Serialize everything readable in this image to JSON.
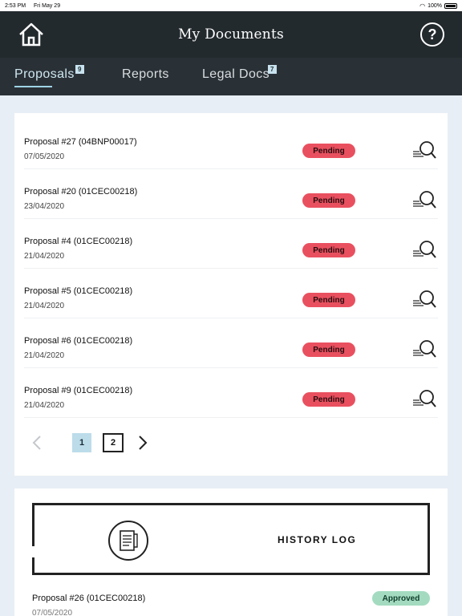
{
  "status_bar": {
    "time": "2:53 PM",
    "date": "Fri May 29",
    "battery": "100%"
  },
  "header": {
    "title": "My Documents"
  },
  "tabs": [
    {
      "label": "Proposals",
      "badge": "9",
      "active": true
    },
    {
      "label": "Reports",
      "badge": "",
      "active": false
    },
    {
      "label": "Legal Docs",
      "badge": "7",
      "active": false
    }
  ],
  "proposals": [
    {
      "title": "Proposal #27 (04BNP00017)",
      "date": "07/05/2020",
      "status": "Pending"
    },
    {
      "title": "Proposal #20 (01CEC00218)",
      "date": "23/04/2020",
      "status": "Pending"
    },
    {
      "title": "Proposal #4 (01CEC00218)",
      "date": "21/04/2020",
      "status": "Pending"
    },
    {
      "title": "Proposal #5 (01CEC00218)",
      "date": "21/04/2020",
      "status": "Pending"
    },
    {
      "title": "Proposal #6 (01CEC00218)",
      "date": "21/04/2020",
      "status": "Pending"
    },
    {
      "title": "Proposal #9 (01CEC00218)",
      "date": "21/04/2020",
      "status": "Pending"
    }
  ],
  "pagination": {
    "pages": [
      "1",
      "2"
    ],
    "current": "1"
  },
  "history": {
    "label": "HISTORY LOG",
    "items": [
      {
        "title": "Proposal #26 (01CEC00218)",
        "date": "07/05/2020",
        "status": "Approved"
      }
    ]
  },
  "colors": {
    "pending": "#e9505f",
    "approved": "#a4dbc0",
    "header": "#232a2e",
    "accent": "#bcdcea"
  }
}
